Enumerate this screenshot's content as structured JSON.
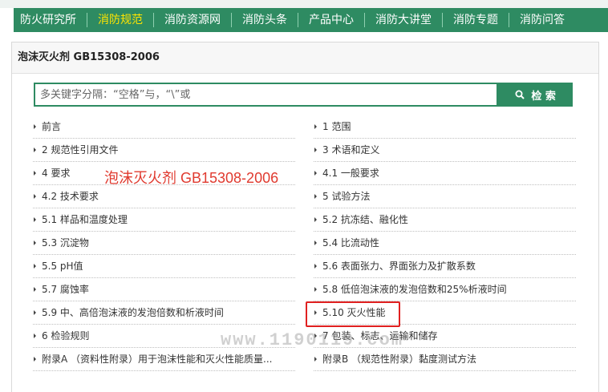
{
  "nav": {
    "items": [
      {
        "label": "防火研究所"
      },
      {
        "label": "消防规范",
        "active": true
      },
      {
        "label": "消防资源网"
      },
      {
        "label": "消防头条"
      },
      {
        "label": "产品中心"
      },
      {
        "label": "消防大讲堂"
      },
      {
        "label": "消防专题"
      },
      {
        "label": "消防问答"
      }
    ]
  },
  "panel": {
    "title": "泡沫灭火剂 GB15308-2006"
  },
  "search": {
    "placeholder": "多关键字分隔：“空格”与，“\\”或",
    "button_label": "检 索"
  },
  "toc": [
    {
      "label": "前言"
    },
    {
      "label": "1 范围"
    },
    {
      "label": "2 规范性引用文件"
    },
    {
      "label": "3 术语和定义"
    },
    {
      "label": "4 要求"
    },
    {
      "label": "4.1 一般要求"
    },
    {
      "label": "4.2 技术要求"
    },
    {
      "label": "5 试验方法"
    },
    {
      "label": "5.1 样品和温度处理"
    },
    {
      "label": "5.2 抗冻结、融化性"
    },
    {
      "label": "5.3 沉淀物"
    },
    {
      "label": "5.4 比流动性"
    },
    {
      "label": "5.5 pH值"
    },
    {
      "label": "5.6 表面张力、界面张力及扩散系数"
    },
    {
      "label": "5.7 腐蚀率"
    },
    {
      "label": "5.8 低倍泡沫液的发泡倍数和25%析液时间"
    },
    {
      "label": "5.9 中、高倍泡沫液的发泡倍数和析液时间"
    },
    {
      "label": "5.10 灭火性能"
    },
    {
      "label": "6 检验规则"
    },
    {
      "label": "7 包装、标志、运输和储存"
    },
    {
      "label": "附录A （资料性附录）用于泡沫性能和灭火性能质量..."
    },
    {
      "label": "附录B （规范性附录）黏度测试方法"
    }
  ],
  "overlay": {
    "title": "泡沫灭火剂 GB15308-2006",
    "watermark": "www.1190119.com"
  },
  "colors": {
    "nav_bg": "#2e8b62",
    "nav_active": "#ffe400",
    "overlay_red": "#e03a2f",
    "highlight_border": "#e02020"
  },
  "icons": {
    "search": "search-icon",
    "bullet": "triangle-right-icon"
  }
}
